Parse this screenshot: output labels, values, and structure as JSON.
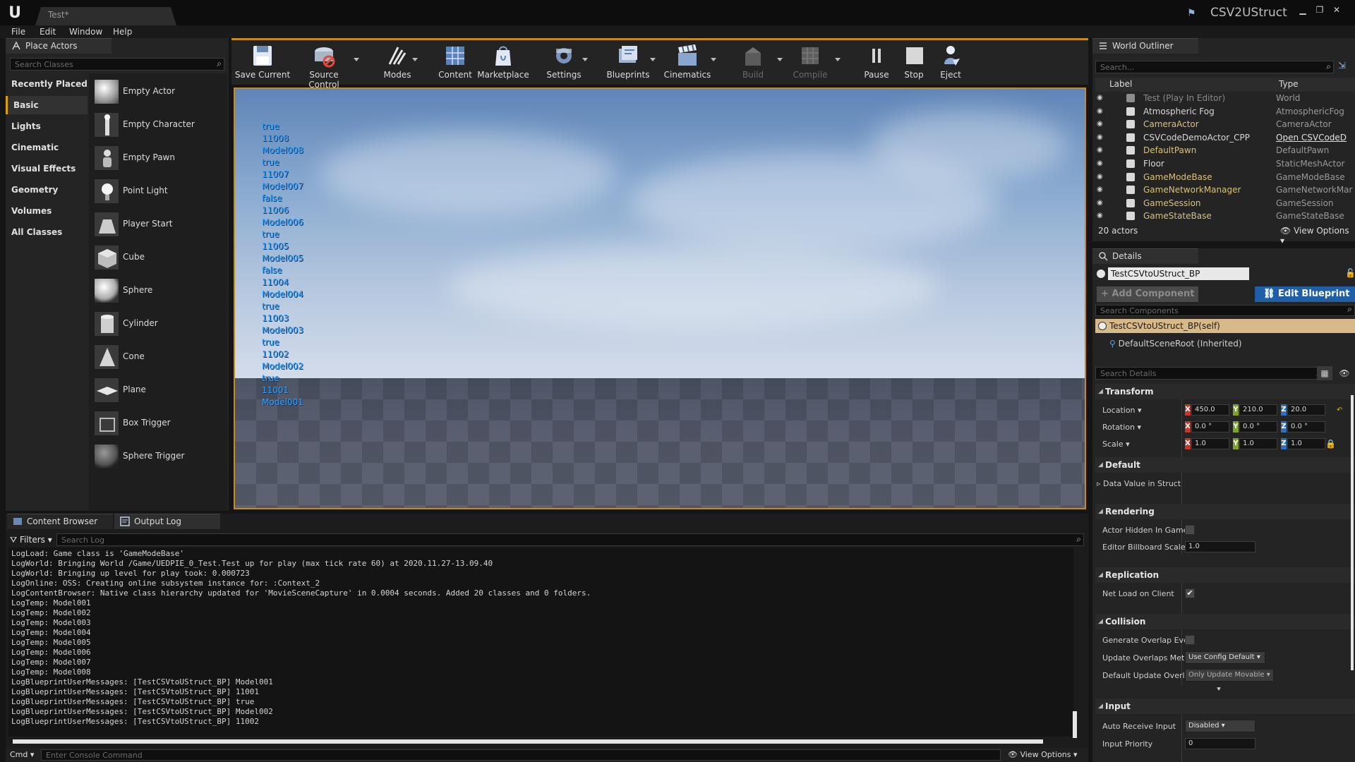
{
  "title_bar": {
    "tab_title": "Test*",
    "project_name": "CSV2UStruct"
  },
  "menu": [
    "File",
    "Edit",
    "Window",
    "Help"
  ],
  "place_actors": {
    "tab": "Place Actors",
    "search_placeholder": "Search Classes",
    "categories": [
      "Recently Placed",
      "Basic",
      "Lights",
      "Cinematic",
      "Visual Effects",
      "Geometry",
      "Volumes",
      "All Classes"
    ],
    "active_category": "Basic",
    "items": [
      "Empty Actor",
      "Empty Character",
      "Empty Pawn",
      "Point Light",
      "Player Start",
      "Cube",
      "Sphere",
      "Cylinder",
      "Cone",
      "Plane",
      "Box Trigger",
      "Sphere Trigger"
    ]
  },
  "toolbar": {
    "save_current": "Save Current",
    "source_control": "Source Control",
    "modes": "Modes",
    "content": "Content",
    "marketplace": "Marketplace",
    "settings": "Settings",
    "blueprints": "Blueprints",
    "cinematics": "Cinematics",
    "build": "Build",
    "compile": "Compile",
    "pause": "Pause",
    "stop": "Stop",
    "eject": "Eject"
  },
  "viewport": {
    "print_lines": [
      "true",
      "11008",
      "Model008",
      "true",
      "11007",
      "Model007",
      "false",
      "11006",
      "Model006",
      "true",
      "11005",
      "Model005",
      "false",
      "11004",
      "Model004",
      "true",
      "11003",
      "Model003",
      "true",
      "11002",
      "Model002",
      "true",
      "11001",
      "Model001"
    ]
  },
  "bottom": {
    "tab_content_browser": "Content Browser",
    "tab_output_log": "Output Log",
    "filters": "Filters",
    "search_log_placeholder": "Search Log",
    "log_lines": [
      "LogLoad: Game class is 'GameModeBase'",
      "LogWorld: Bringing World /Game/UEDPIE_0_Test.Test up for play (max tick rate 60) at 2020.11.27-13.09.40",
      "LogWorld: Bringing up level for play took: 0.000723",
      "LogOnline: OSS: Creating online subsystem instance for: :Context_2",
      "LogContentBrowser: Native class hierarchy updated for 'MovieSceneCapture' in 0.0004 seconds. Added 20 classes and 0 folders.",
      "LogTemp: Model001",
      "LogTemp: Model002",
      "LogTemp: Model003",
      "LogTemp: Model004",
      "LogTemp: Model005",
      "LogTemp: Model006",
      "LogTemp: Model007",
      "LogTemp: Model008",
      "LogBlueprintUserMessages: [TestCSVtoUStruct_BP] Model001",
      "LogBlueprintUserMessages: [TestCSVtoUStruct_BP] 11001",
      "LogBlueprintUserMessages: [TestCSVtoUStruct_BP] true",
      "LogBlueprintUserMessages: [TestCSVtoUStruct_BP] Model002",
      "LogBlueprintUserMessages: [TestCSVtoUStruct_BP] 11002"
    ],
    "cmd_label": "Cmd",
    "console_placeholder": "Enter Console Command",
    "view_options": "View Options"
  },
  "outliner": {
    "tab": "World Outliner",
    "search_placeholder": "Search...",
    "col_label": "Label",
    "col_type": "Type",
    "rows": [
      {
        "label": "Test (Play In Editor)",
        "type": "World"
      },
      {
        "label": "Atmospheric Fog",
        "type": "AtmosphericFog"
      },
      {
        "label": "CameraActor",
        "type": "CameraActor"
      },
      {
        "label": "CSVCodeDemoActor_CPP",
        "type": "Open CSVCodeD"
      },
      {
        "label": "DefaultPawn",
        "type": "DefaultPawn"
      },
      {
        "label": "Floor",
        "type": "StaticMeshActor"
      },
      {
        "label": "GameModeBase",
        "type": "GameModeBase"
      },
      {
        "label": "GameNetworkManager",
        "type": "GameNetworkMar"
      },
      {
        "label": "GameSession",
        "type": "GameSession"
      },
      {
        "label": "GameStateBase",
        "type": "GameStateBase"
      }
    ],
    "actor_count": "20 actors",
    "view_options": "View Options"
  },
  "details": {
    "tab": "Details",
    "object_name": "TestCSVtoUStruct_BP",
    "add_component": "+ Add Component",
    "edit_blueprint": "Edit Blueprint",
    "search_components_placeholder": "Search Components",
    "self_component": "TestCSVtoUStruct_BP(self)",
    "default_root": "DefaultSceneRoot (Inherited)",
    "search_details_placeholder": "Search Details",
    "transform": {
      "section": "Transform",
      "location_label": "Location",
      "rotation_label": "Rotation",
      "scale_label": "Scale",
      "location": [
        "450.0",
        "210.0",
        "20.0"
      ],
      "rotation": [
        "0.0 °",
        "0.0 °",
        "0.0 °"
      ],
      "scale": [
        "1.0",
        "1.0",
        "1.0"
      ]
    },
    "default_section": "Default",
    "data_value_label": "Data Value in Struct",
    "rendering": {
      "section": "Rendering",
      "actor_hidden_label": "Actor Hidden In Game",
      "billboard_scale_label": "Editor Billboard Scale",
      "billboard_scale_value": "1.0"
    },
    "replication": {
      "section": "Replication",
      "net_load_label": "Net Load on Client",
      "net_load_checked": true
    },
    "collision": {
      "section": "Collision",
      "generate_overlap_label": "Generate Overlap Ever",
      "update_overlaps_label": "Update Overlaps Meth",
      "update_overlaps_value": "Use Config Default",
      "default_update_label": "Default Update Overla",
      "default_update_value": "Only Update Movable"
    },
    "input": {
      "section": "Input",
      "auto_receive_label": "Auto Receive Input",
      "auto_receive_value": "Disabled",
      "priority_label": "Input Priority",
      "priority_value": "0"
    }
  },
  "colors": {
    "accent_orange": "#c88b1a",
    "print_blue": "#2da3ff",
    "edit_blueprint_bg": "#1f5fa8",
    "selected_row": "#d7b98a"
  }
}
